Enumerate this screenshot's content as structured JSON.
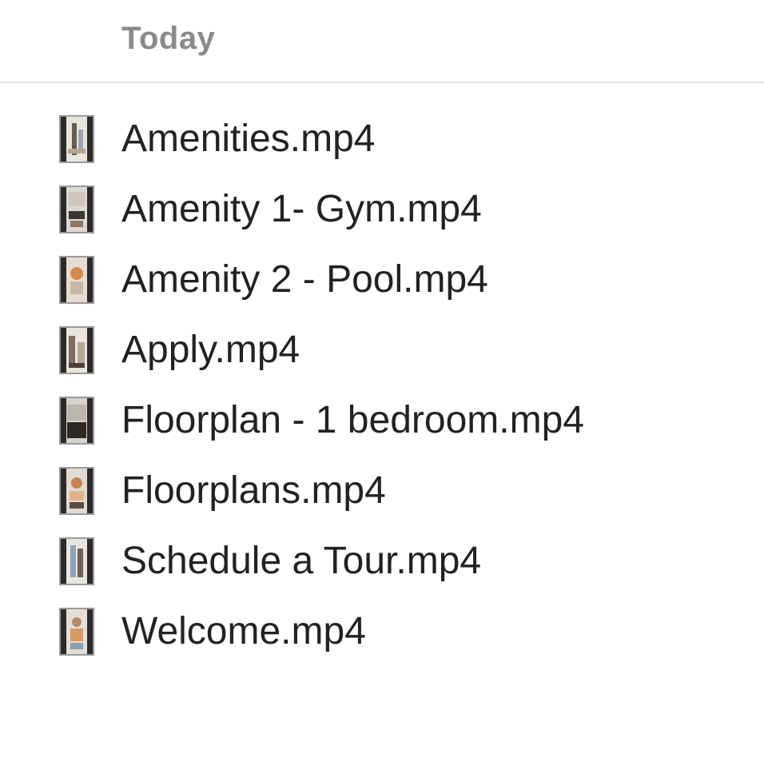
{
  "group": {
    "label": "Today"
  },
  "files": [
    {
      "name": "Amenities.mp4",
      "icon": "video-thumbnail-icon"
    },
    {
      "name": "Amenity 1- Gym.mp4",
      "icon": "video-thumbnail-icon"
    },
    {
      "name": "Amenity 2 - Pool.mp4",
      "icon": "video-thumbnail-icon"
    },
    {
      "name": "Apply.mp4",
      "icon": "video-thumbnail-icon"
    },
    {
      "name": "Floorplan - 1 bedroom.mp4",
      "icon": "video-thumbnail-icon"
    },
    {
      "name": "Floorplans.mp4",
      "icon": "video-thumbnail-icon"
    },
    {
      "name": "Schedule a Tour.mp4",
      "icon": "video-thumbnail-icon"
    },
    {
      "name": "Welcome.mp4",
      "icon": "video-thumbnail-icon"
    }
  ],
  "colors": {
    "header_text": "#8a8a8a",
    "file_text": "#222222",
    "divider": "#e3e3e3"
  }
}
